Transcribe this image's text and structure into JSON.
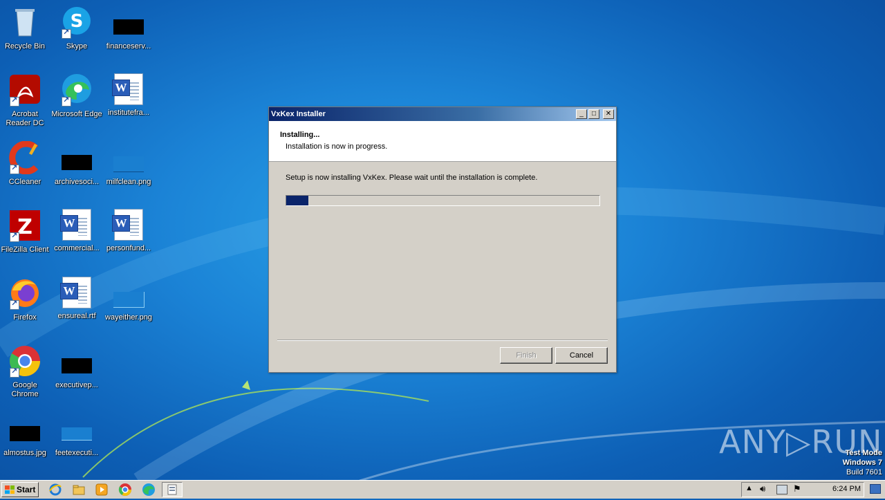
{
  "desktop": {
    "icons": [
      {
        "label": "Recycle Bin"
      },
      {
        "label": "Skype"
      },
      {
        "label": "financeserv..."
      },
      {
        "label": "Acrobat Reader DC"
      },
      {
        "label": "Microsoft Edge"
      },
      {
        "label": "institutefra..."
      },
      {
        "label": "CCleaner"
      },
      {
        "label": "archivesoci..."
      },
      {
        "label": "milfclean.png"
      },
      {
        "label": "FileZilla Client"
      },
      {
        "label": "commercial..."
      },
      {
        "label": "personfund..."
      },
      {
        "label": "Firefox"
      },
      {
        "label": "ensureal.rtf"
      },
      {
        "label": "wayeither.png"
      },
      {
        "label": "Google Chrome"
      },
      {
        "label": "executivep..."
      },
      {
        "label": "almostus.jpg"
      },
      {
        "label": "feetexecuti..."
      }
    ]
  },
  "window": {
    "title": "VxKex Installer",
    "header_title": "Installing...",
    "header_subtitle": "Installation is now in progress.",
    "body_text": "Setup is now installing VxKex. Please wait until the installation is complete.",
    "progress_percent": 7,
    "finish_label": "Finish",
    "cancel_label": "Cancel",
    "minimize_glyph": "_",
    "maximize_glyph": "□",
    "close_glyph": "✕"
  },
  "taskbar": {
    "start_label": "Start",
    "clock": "6:24 PM",
    "icons": [
      "internet-explorer-icon",
      "explorer-icon",
      "media-player-icon",
      "chrome-icon",
      "edge-icon",
      "installer-icon"
    ]
  },
  "watermark": {
    "line1": "Test Mode",
    "line2": "Windows 7",
    "line3": "Build 7601",
    "brand": "ANY▷RUN"
  },
  "colors": {
    "desktop_blue": "#1b83d6",
    "titlebar_dark": "#0a246a",
    "progress_fill": "#0a246a"
  }
}
